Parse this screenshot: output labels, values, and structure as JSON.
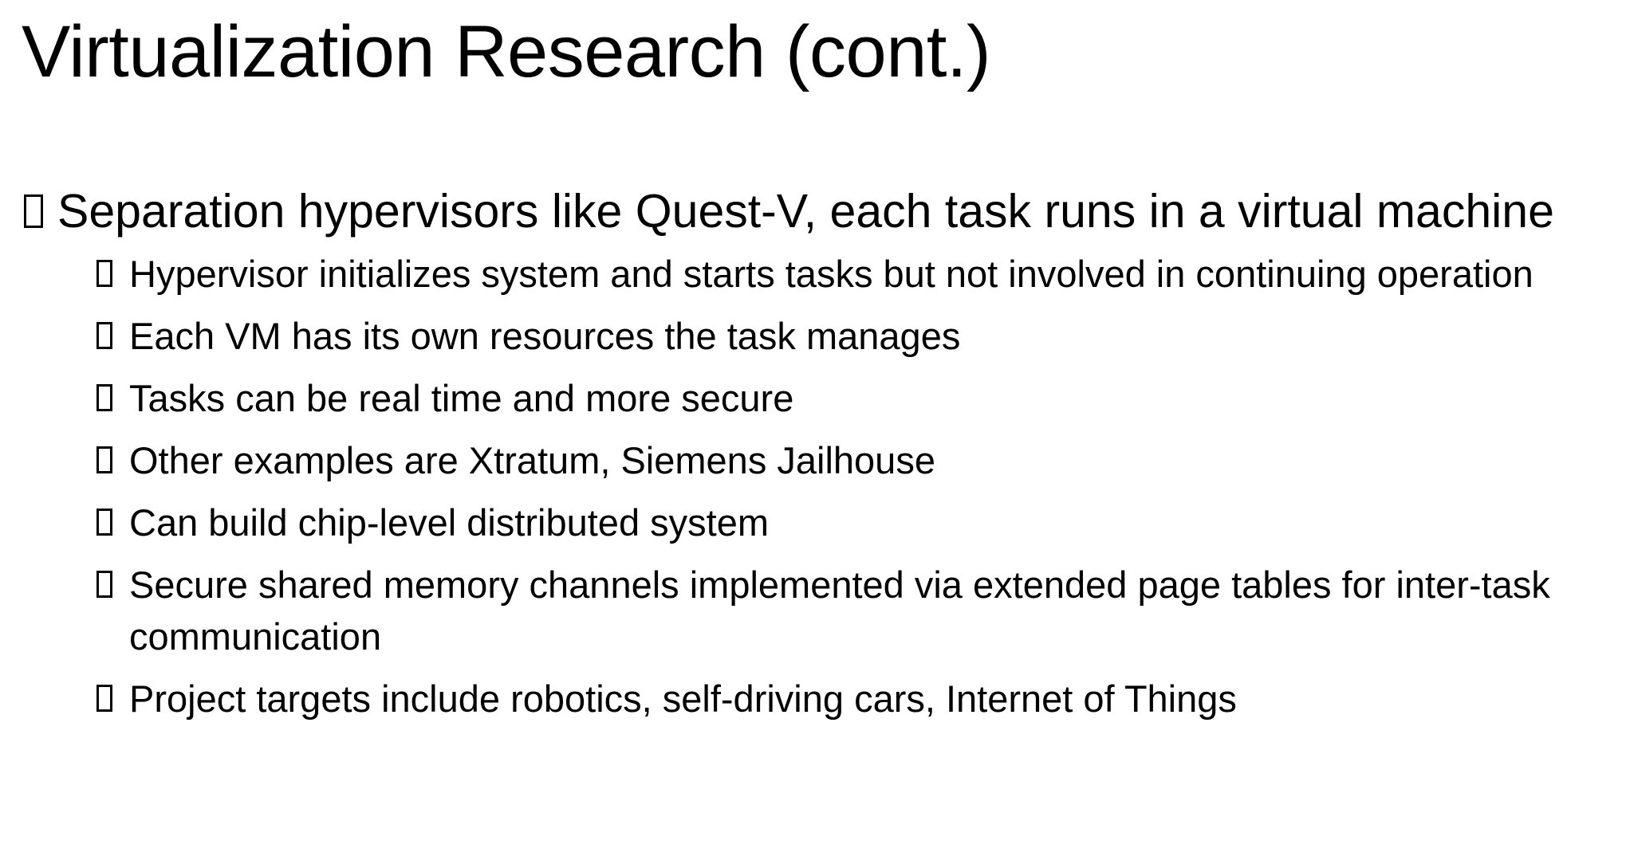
{
  "slide": {
    "title": "Virtualization Research (cont.)",
    "bullets": [
      {
        "text": "Separation hypervisors like Quest-V, each task runs in a virtual machine",
        "icon": "square-bullet-icon",
        "sub_bullets": [
          {
            "text": "Hypervisor initializes system and starts tasks but not involved in continuing operation",
            "icon": "square-bullet-icon"
          },
          {
            "text": "Each VM has its own resources the task manages",
            "icon": "square-bullet-icon"
          },
          {
            "text": "Tasks can be real time and more secure",
            "icon": "square-bullet-icon"
          },
          {
            "text": "Other examples are Xtratum, Siemens Jailhouse",
            "icon": "square-bullet-icon"
          },
          {
            "text": "Can build chip-level distributed system",
            "icon": "square-bullet-icon"
          },
          {
            "text": "Secure shared memory channels implemented via extended page tables for inter-task communication",
            "icon": "square-bullet-icon"
          },
          {
            "text": "Project targets include robotics, self-driving cars, Internet of Things",
            "icon": "square-bullet-icon"
          }
        ]
      }
    ]
  }
}
